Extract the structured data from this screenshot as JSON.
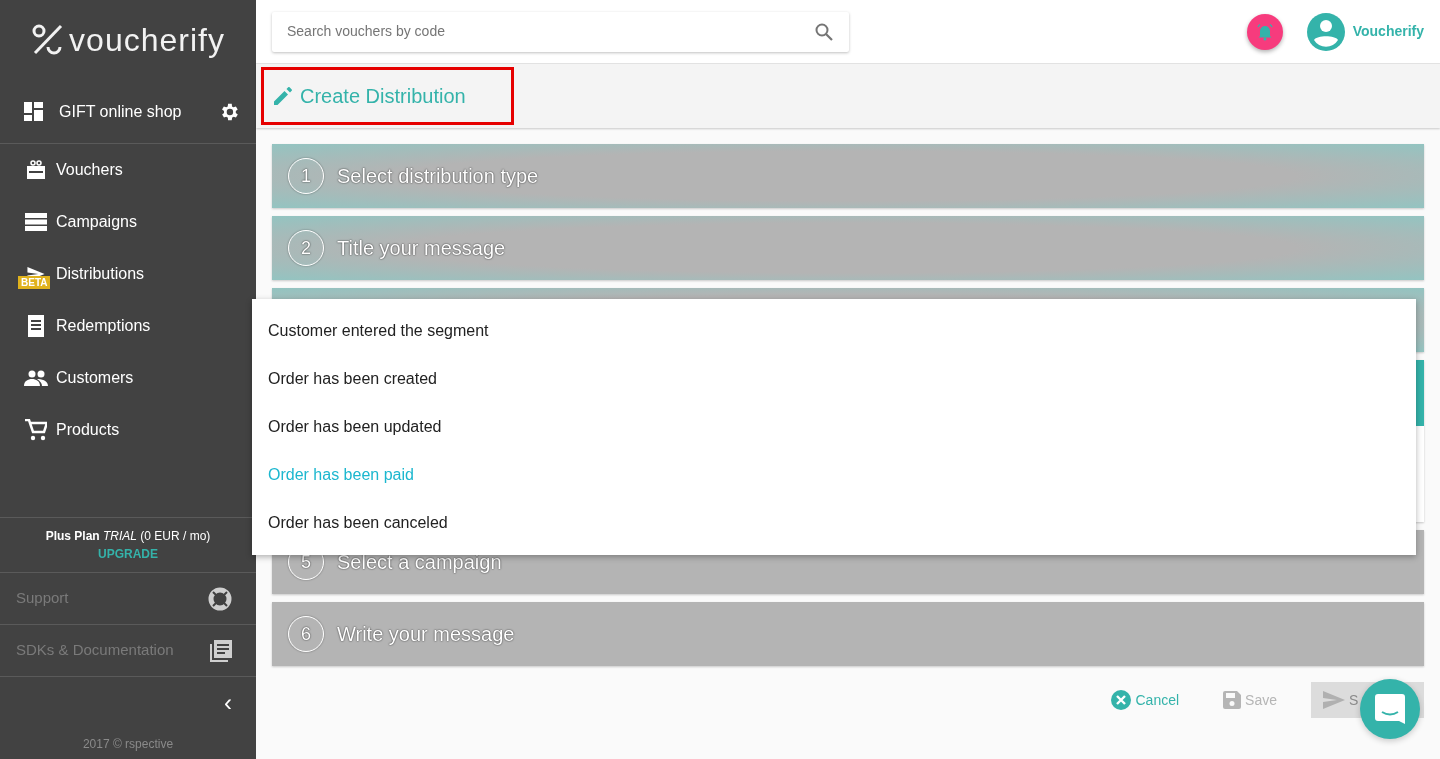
{
  "sidebar": {
    "brand": "voucherify",
    "project": "GIFT online shop",
    "items": [
      {
        "label": "Vouchers"
      },
      {
        "label": "Campaigns"
      },
      {
        "label": "Distributions",
        "badge": "BETA"
      },
      {
        "label": "Redemptions"
      },
      {
        "label": "Customers"
      },
      {
        "label": "Products"
      }
    ],
    "plan": "**Plus Plan** *TRIAL* (0 EUR / mo)",
    "upgrade": "UPGRADE",
    "links": [
      {
        "label": "Support"
      },
      {
        "label": "SDKs & Documentation"
      }
    ],
    "collapse": "‹",
    "footer": "2017 © rspective"
  },
  "search": {
    "placeholder": "Search vouchers by code"
  },
  "user": {
    "name": "Voucherify"
  },
  "page_title": "Create Distribution",
  "steps": [
    {
      "number": "1",
      "title": "Select distribution type",
      "kind": "done"
    },
    {
      "number": "2",
      "title": "Title your message",
      "kind": "done"
    },
    {
      "kind": "done"
    },
    {
      "kind": "active"
    },
    {
      "number": "5",
      "title": "Select a campaign",
      "kind": "pending"
    },
    {
      "number": "6",
      "title": "Write your message",
      "kind": "pending"
    }
  ],
  "dropdown": [
    {
      "label": "Customer entered the segment",
      "selected": false
    },
    {
      "label": "Order has been created",
      "selected": false
    },
    {
      "label": "Order has been updated",
      "selected": false
    },
    {
      "label": "Order has been paid",
      "selected": true
    },
    {
      "label": "Order has been canceled",
      "selected": false
    }
  ],
  "actions": [
    {
      "label": "Cancel",
      "kind": "cancel",
      "disabled": false
    },
    {
      "label": "Save",
      "kind": "save",
      "disabled": true
    },
    {
      "label": "S",
      "kind": "send",
      "disabled": true
    }
  ]
}
